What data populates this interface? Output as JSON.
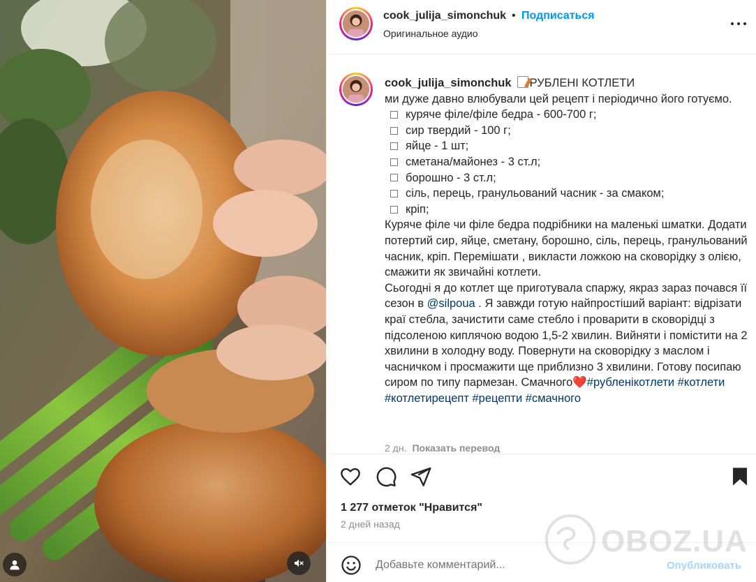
{
  "header": {
    "username": "cook_julija_simonchuk",
    "separator": "•",
    "follow_label": "Подписаться",
    "audio": "Оригинальное аудио",
    "more_icon": "more-horizontal-icon"
  },
  "caption": {
    "username": "cook_julija_simonchuk",
    "title": "РУБЛЕНІ КОТЛЕТИ",
    "intro": "ми дуже давно влюбували цей рецепт і періодично його готуємо.",
    "ingredients": [
      "куряче філе/філе бедра - 600-700 г;",
      "сир твердий - 100 г;",
      "яйце - 1 шт;",
      "сметана/майонез - 3 ст.л;",
      "борошно - 3 ст.л;",
      "сіль, перець, гранульований часник - за смаком;",
      "кріп;"
    ],
    "method": "Куряче філе чи філе бедра подрібники на маленькі шматки. Додати потертий сир, яйце, сметану, борошно, сіль, перець, гранульований часник, кріп. Перемішати , викласти ложкою на сковорідку з олією, смажити як звичайні котлети.",
    "asparagus_before": "Сьогодні я до котлет ще приготувала спаржу, якраз зараз почався її сезон в ",
    "mention": "@silpoua",
    "asparagus_after": " . Я завжди готую найпростіший варіант: відрізати краї стебла, зачистити саме стебло і проварити в сковорідці з підсоленою киплячою водою 1,5-2 хвилин. Вийняти і помістити на 2 хвилини в холодну воду. Повернути на сковорідку з маслом і часничком і просмажити ще приблизно 3 хвилини. Готову посипаю сиром по типу пармезан. Смачного",
    "heart": "❤️",
    "hashtags": [
      "#рубленікотлети",
      "#котлети",
      "#котлетирецепт",
      "#рецепти",
      "#смачного"
    ],
    "age": "2 дн.",
    "translate_label": "Показать перевод"
  },
  "actions": {
    "like_icon": "heart-icon",
    "comment_icon": "comment-icon",
    "share_icon": "share-icon",
    "save_icon": "bookmark-icon"
  },
  "stats": {
    "likes": "1 277 отметок \"Нравится\"",
    "posted": "2 дней назад"
  },
  "comment": {
    "placeholder": "Добавьте комментарий...",
    "publish_label": "Опубликовать"
  },
  "media": {
    "mute_icon": "speaker-muted-icon",
    "avatar_icon": "user-icon"
  },
  "watermark": {
    "text": "OBOZ.UA"
  }
}
